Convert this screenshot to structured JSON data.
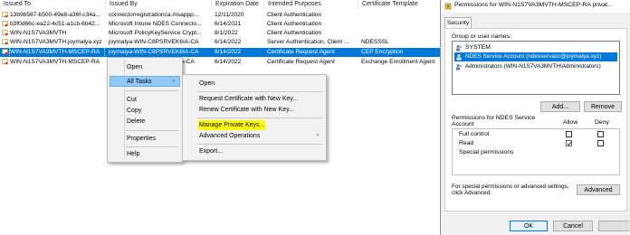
{
  "columns": [
    "Issued To",
    "Issued By",
    "Expiration Date",
    "Intended Purposes",
    "Certificate Template"
  ],
  "rows": [
    {
      "issued_to": "13b9b587-b500-49e8-a36f-c34a...",
      "issued_by": "connectorregistrationca.msappp...",
      "expiration": "12/11/2020",
      "purposes": "Client Authentication",
      "template": ""
    },
    {
      "issued_to": "b3f0d66c-ea22-4c51-a1cb-6b42...",
      "issued_by": "Microsoft Intune NDES Connecto...",
      "expiration": "6/14/2021",
      "purposes": "Client Authentication",
      "template": ""
    },
    {
      "issued_to": "WIN-N1S7VA3MVTH",
      "issued_by": "Microsoft PolicyKeyService Crypt...",
      "expiration": "8/1/2022",
      "purposes": "Client Authentication",
      "template": ""
    },
    {
      "issued_to": "WIN-N1S7VA3MVTH.joymalya.xyz",
      "issued_by": "joymalya-WIN-C8PSRVEK6IA-CA",
      "expiration": "6/14/2022",
      "purposes": "Server Authentication, Client ...",
      "template": "NDESSSL"
    },
    {
      "issued_to": "WIN-N1S7VA3MVTH-MSCEP-RA",
      "issued_by": "joymalya-WIN-C8PSRVEK6IA-CA",
      "expiration": "6/14/2022",
      "purposes": "Certificate Request Agent",
      "template": "CEP Encryption"
    },
    {
      "issued_to": "WIN-N1S7VA3MVTH-MSCEP-RA",
      "issued_by": "A-CA",
      "expiration": "6/14/2022",
      "purposes": "Certificate Request Agent",
      "template": "Exchange Enrollment Agent"
    }
  ],
  "context_menu": {
    "open": "Open",
    "all_tasks": "All Tasks",
    "cut": "Cut",
    "copy": "Copy",
    "delete": "Delete",
    "properties": "Properties",
    "help": "Help"
  },
  "submenu": {
    "open": "Open",
    "request_new_key": "Request Certificate with New Key...",
    "renew_new_key": "Renew Certificate with New Key...",
    "manage_private_keys": "Manage Private Keys...",
    "advanced_operations": "Advanced Operations",
    "export": "Export..."
  },
  "dialog": {
    "title": "Permissions for WIN-N1S7VA3MVTH-MSCEP-RA privat...",
    "tab": "Security",
    "group_label": "Group or user names:",
    "users": [
      {
        "name": "SYSTEM"
      },
      {
        "name": "NDES Service Account (ndesservacc@joymalya.xyz)"
      },
      {
        "name": "Administrators (WIN-N1S7VA3MVTH\\Administrators)"
      }
    ],
    "add_label": "Add...",
    "remove_label": "Remove",
    "perm_label_line1": "Permissions for NDES Service",
    "perm_label_line2": "Account",
    "allow_label": "Allow",
    "deny_label": "Deny",
    "permissions": [
      {
        "name": "Full control",
        "allow": false,
        "deny": false
      },
      {
        "name": "Read",
        "allow": true,
        "deny": false
      },
      {
        "name": "Special permissions",
        "allow": false,
        "deny": false
      }
    ],
    "advanced_text_line1": "For special permissions or advanced settings,",
    "advanced_text_line2": "click Advanced.",
    "advanced_label": "Advanced",
    "ok_label": "OK",
    "cancel_label": "Cancel"
  },
  "colors": {
    "selection": "#0078d7",
    "highlight": "#ffff00",
    "menu_hover": "#91c9f7"
  }
}
